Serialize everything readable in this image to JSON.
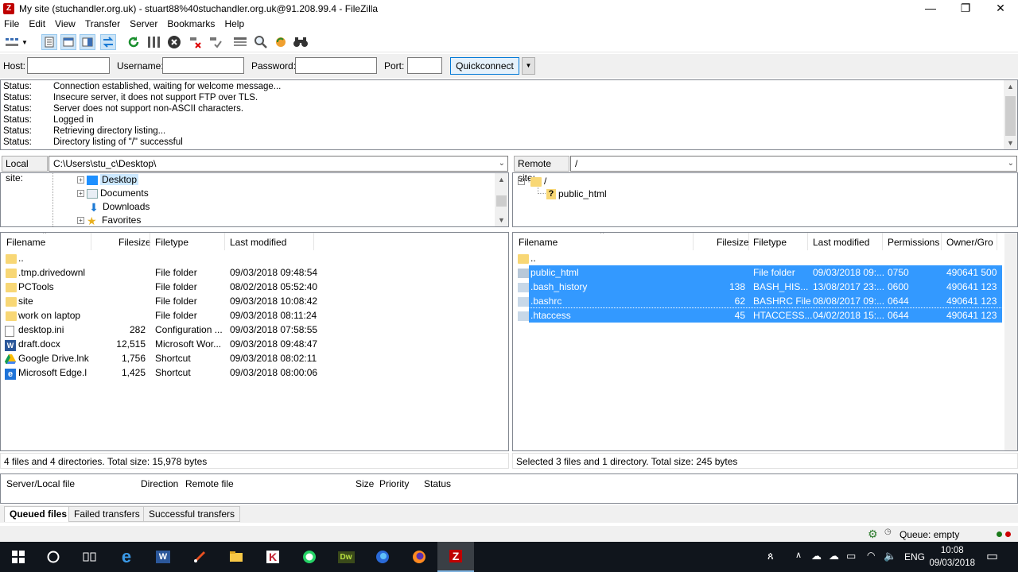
{
  "window": {
    "title": "My site (stuchandler.org.uk) - stuart88%40stuchandler.org.uk@91.208.99.4 - FileZilla",
    "minimize": "—",
    "maximize": "❐",
    "close": "✕"
  },
  "menu": [
    "File",
    "Edit",
    "View",
    "Transfer",
    "Server",
    "Bookmarks",
    "Help"
  ],
  "toolbar": {
    "icons": [
      "site-manager-icon",
      "dropdown-icon",
      "toggle-log-icon",
      "toggle-local-tree-icon",
      "toggle-remote-tree-icon",
      "toggle-queue-icon",
      "refresh-icon",
      "process-queue-icon",
      "cancel-icon",
      "disconnect-icon",
      "reconnect-icon",
      "directory-listing-filters-icon",
      "compare-icon",
      "synchronized-browsing-icon",
      "search-icon"
    ]
  },
  "quickconnect": {
    "host_label": "Host:",
    "username_label": "Username:",
    "password_label": "Password:",
    "port_label": "Port:",
    "button": "Quickconnect",
    "dropdown": "▼"
  },
  "log": [
    {
      "status": "Status:",
      "text": "Connection established, waiting for welcome message..."
    },
    {
      "status": "Status:",
      "text": "Insecure server, it does not support FTP over TLS."
    },
    {
      "status": "Status:",
      "text": "Server does not support non-ASCII characters."
    },
    {
      "status": "Status:",
      "text": "Logged in"
    },
    {
      "status": "Status:",
      "text": "Retrieving directory listing..."
    },
    {
      "status": "Status:",
      "text": "Directory listing of \"/\" successful"
    }
  ],
  "local": {
    "label": "Local site:",
    "path": "C:\\Users\\stu_c\\Desktop\\",
    "tree": [
      "Desktop",
      "Documents",
      "Downloads",
      "Favorites"
    ],
    "columns": [
      "Filename",
      "Filesize",
      "Filetype",
      "Last modified"
    ],
    "files": [
      {
        "name": "..",
        "size": "",
        "type": "",
        "modified": ""
      },
      {
        "name": ".tmp.drivedownl",
        "size": "",
        "type": "File folder",
        "modified": "09/03/2018 09:48:54"
      },
      {
        "name": "PCTools",
        "size": "",
        "type": "File folder",
        "modified": "08/02/2018 05:52:40"
      },
      {
        "name": "site",
        "size": "",
        "type": "File folder",
        "modified": "09/03/2018 10:08:42"
      },
      {
        "name": "work on laptop",
        "size": "",
        "type": "File folder",
        "modified": "09/03/2018 08:11:24"
      },
      {
        "name": "desktop.ini",
        "size": "282",
        "type": "Configuration ...",
        "modified": "09/03/2018 07:58:55"
      },
      {
        "name": "draft.docx",
        "size": "12,515",
        "type": "Microsoft Wor...",
        "modified": "09/03/2018 09:48:47"
      },
      {
        "name": "Google Drive.lnk",
        "size": "1,756",
        "type": "Shortcut",
        "modified": "09/03/2018 08:02:11"
      },
      {
        "name": "Microsoft Edge.l",
        "size": "1,425",
        "type": "Shortcut",
        "modified": "09/03/2018 08:00:06"
      }
    ],
    "status": "4 files and 4 directories. Total size: 15,978 bytes"
  },
  "remote": {
    "label": "Remote site:",
    "path": "/",
    "tree": [
      "/",
      "public_html"
    ],
    "columns": [
      "Filename",
      "Filesize",
      "Filetype",
      "Last modified",
      "Permissions",
      "Owner/Gro"
    ],
    "files": [
      {
        "name": "..",
        "size": "",
        "type": "",
        "modified": "",
        "perms": "",
        "owner": ""
      },
      {
        "name": "public_html",
        "size": "",
        "type": "File folder",
        "modified": "09/03/2018 09:...",
        "perms": "0750",
        "owner": "490641 500"
      },
      {
        "name": ".bash_history",
        "size": "138",
        "type": "BASH_HIS...",
        "modified": "13/08/2017 23:...",
        "perms": "0600",
        "owner": "490641 123"
      },
      {
        "name": ".bashrc",
        "size": "62",
        "type": "BASHRC File",
        "modified": "08/08/2017 09:...",
        "perms": "0644",
        "owner": "490641 123"
      },
      {
        "name": ".htaccess",
        "size": "45",
        "type": "HTACCESS...",
        "modified": "04/02/2018 15:...",
        "perms": "0644",
        "owner": "490641 123"
      }
    ],
    "status": "Selected 3 files and 1 directory. Total size: 245 bytes"
  },
  "queue": {
    "columns": [
      "Server/Local file",
      "Direction",
      "Remote file",
      "Size",
      "Priority",
      "Status"
    ]
  },
  "tabs": [
    "Queued files",
    "Failed transfers",
    "Successful transfers"
  ],
  "statusbar": {
    "queue": "Queue: empty"
  },
  "taskbar": {
    "apps": [
      "start-icon",
      "cortana-icon",
      "task-view-icon",
      "edge-icon",
      "word-icon",
      "paint-icon",
      "file-explorer-icon",
      "kaspersky-icon",
      "whatsapp-icon",
      "dreamweaver-icon",
      "firefox-dev-icon",
      "firefox-icon",
      "filezilla-icon"
    ],
    "lang": "ENG",
    "time": "10:08",
    "date": "09/03/2018"
  },
  "colors": {
    "selection": "#3399ff",
    "folder": "#f8d775",
    "taskbar": "#10151c"
  }
}
